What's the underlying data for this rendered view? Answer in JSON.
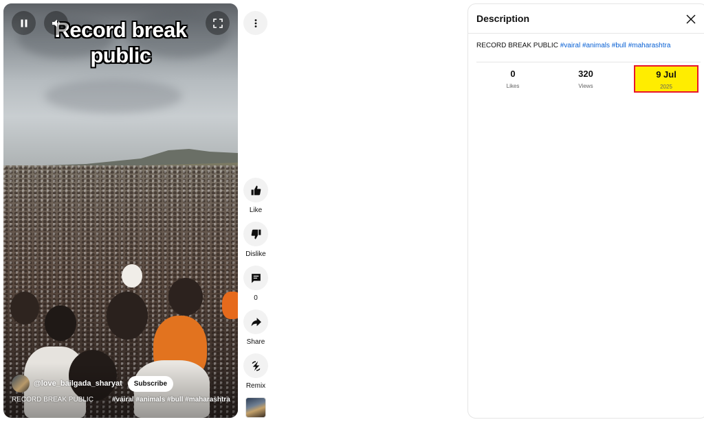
{
  "player": {
    "overlay_text_line1": "Record break",
    "overlay_text_line2": "public",
    "channel_handle": "@love_bailgada_sharyat",
    "subscribe_label": "Subscribe",
    "video_title": "RECORD BREAK PUBLIC",
    "video_tags": "#vairal #animals #bull #maharashtra",
    "icons": [
      "pause-icon",
      "volume-icon",
      "fullscreen-icon"
    ]
  },
  "actions": {
    "like_label": "Like",
    "dislike_label": "Dislike",
    "comments_count": "0",
    "share_label": "Share",
    "remix_label": "Remix"
  },
  "description_panel": {
    "title": "Description",
    "text": "RECORD BREAK PUBLIC",
    "hashtags": [
      "#vairal",
      "#animals",
      "#bull",
      "#maharashtra"
    ],
    "stats": {
      "likes_value": "0",
      "likes_label": "Likes",
      "views_value": "320",
      "views_label": "Views",
      "date_value": "9 Jul",
      "date_year": "2025"
    },
    "highlight_color": "#ffed00",
    "highlight_border": "#e8152a",
    "link_color": "#065fd4"
  }
}
